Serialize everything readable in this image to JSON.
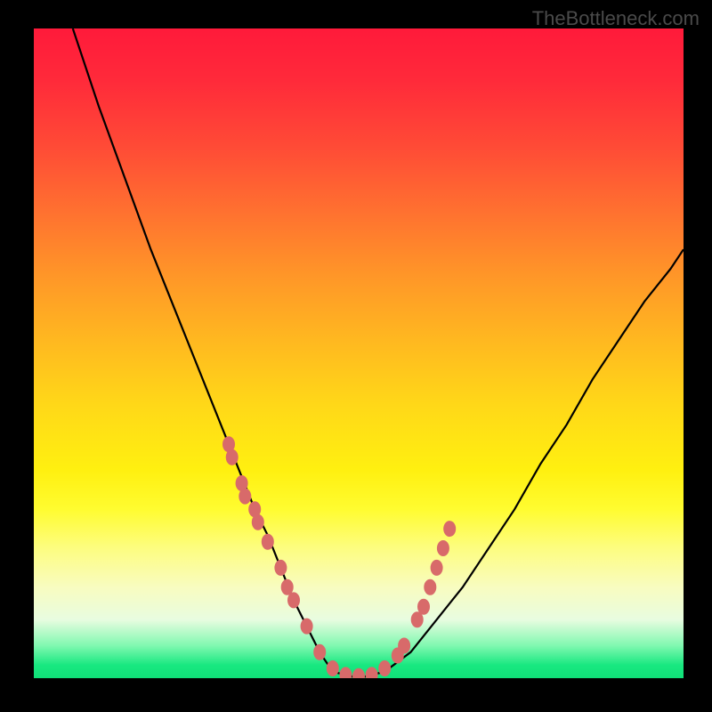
{
  "watermark": "TheBottleneck.com",
  "chart_data": {
    "type": "line",
    "title": "",
    "xlabel": "",
    "ylabel": "",
    "xlim": [
      0,
      100
    ],
    "ylim": [
      0,
      100
    ],
    "grid": false,
    "series": [
      {
        "name": "curve",
        "x": [
          6,
          10,
          14,
          18,
          22,
          26,
          30,
          34,
          36,
          38,
          40,
          42,
          44,
          46,
          50,
          54,
          58,
          62,
          66,
          70,
          74,
          78,
          82,
          86,
          90,
          94,
          98,
          100
        ],
        "values": [
          100,
          88,
          77,
          66,
          56,
          46,
          36,
          26,
          22,
          17,
          12,
          8,
          4,
          1,
          0,
          1,
          4,
          9,
          14,
          20,
          26,
          33,
          39,
          46,
          52,
          58,
          63,
          66
        ]
      }
    ],
    "scatter_points": {
      "name": "markers",
      "x": [
        30,
        30.5,
        32,
        32.5,
        34,
        34.5,
        36,
        38,
        39,
        40,
        42,
        44,
        46,
        48,
        50,
        52,
        54,
        56,
        57,
        59,
        60,
        61,
        62,
        63,
        64
      ],
      "y": [
        36,
        34,
        30,
        28,
        26,
        24,
        21,
        17,
        14,
        12,
        8,
        4,
        1.5,
        0.5,
        0.3,
        0.5,
        1.5,
        3.5,
        5,
        9,
        11,
        14,
        17,
        20,
        23
      ]
    },
    "background_gradient": {
      "stops": [
        {
          "pos": 0,
          "color": "#ff1a3a"
        },
        {
          "pos": 50,
          "color": "#ffd818"
        },
        {
          "pos": 75,
          "color": "#fffc30"
        },
        {
          "pos": 100,
          "color": "#10e078"
        }
      ]
    }
  }
}
